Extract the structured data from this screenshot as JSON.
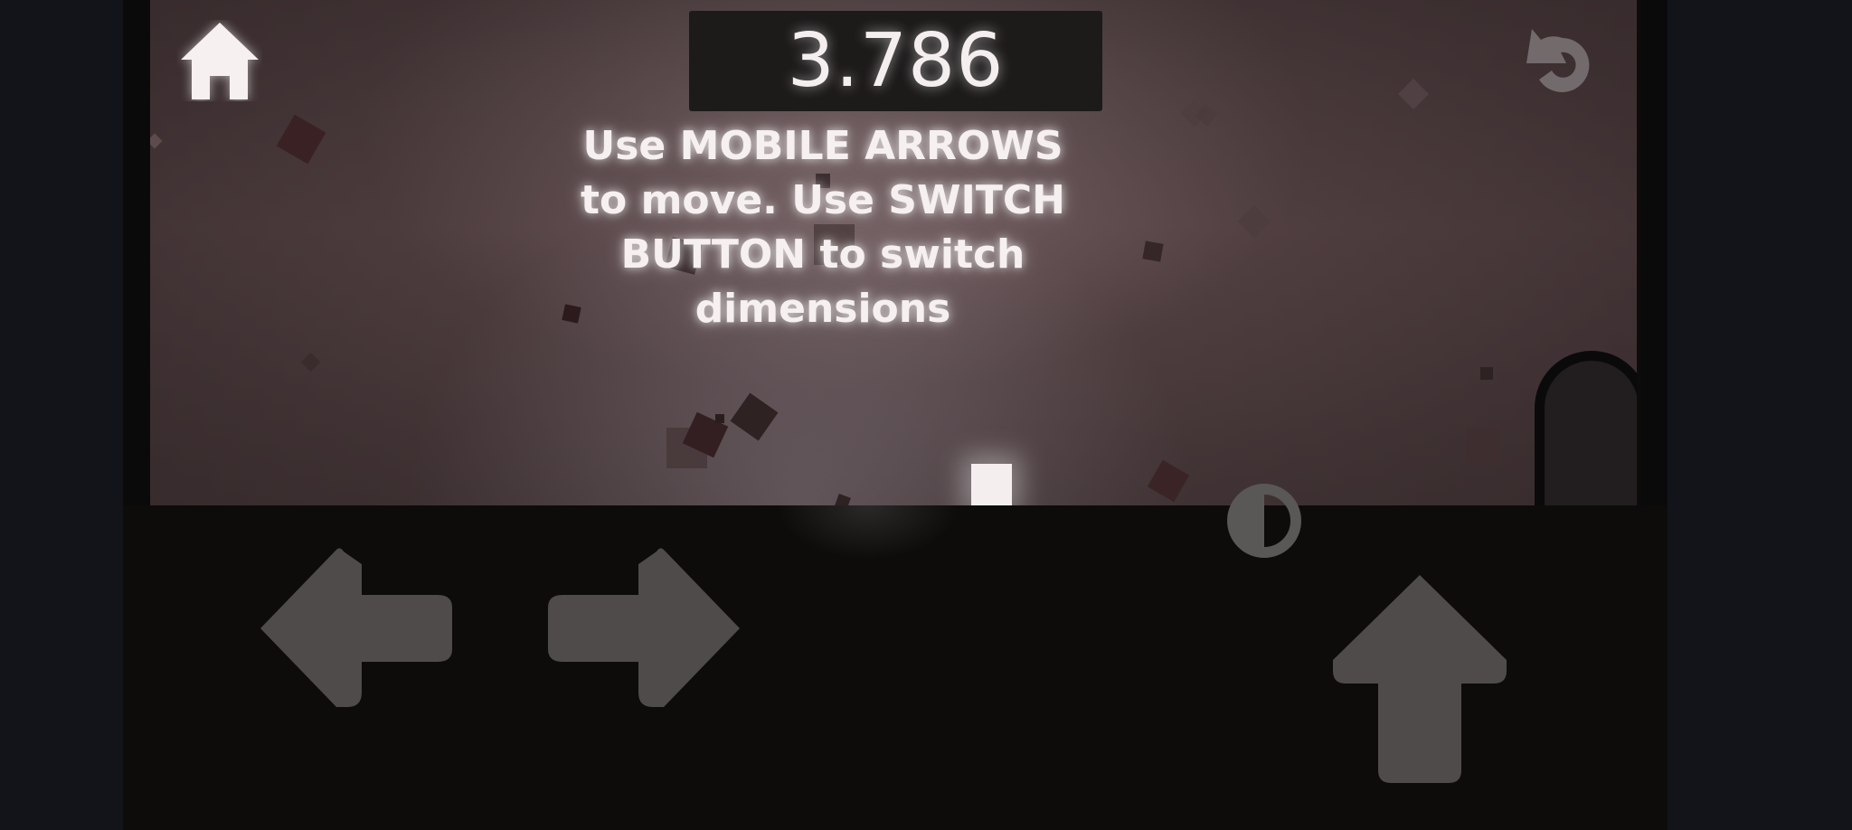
{
  "hud": {
    "timer": "3.786",
    "home_icon": "home-icon",
    "restart_icon": "restart-icon"
  },
  "instructions": {
    "line1": "Use MOBILE ARROWS",
    "line2": "to move.  Use SWITCH",
    "line3": "BUTTON to switch",
    "line4": "dimensions"
  },
  "controls": {
    "left_icon": "left-arrow-icon",
    "right_icon": "right-arrow-icon",
    "jump_icon": "up-arrow-icon",
    "switch_icon": "half-circle-switch-icon"
  },
  "colors": {
    "background_outer": "#12141a",
    "scene_base": "#5e4a4c",
    "ground": "#0d0c0b",
    "player": "#f4eeee",
    "control_fill": "#4d4a4a"
  }
}
